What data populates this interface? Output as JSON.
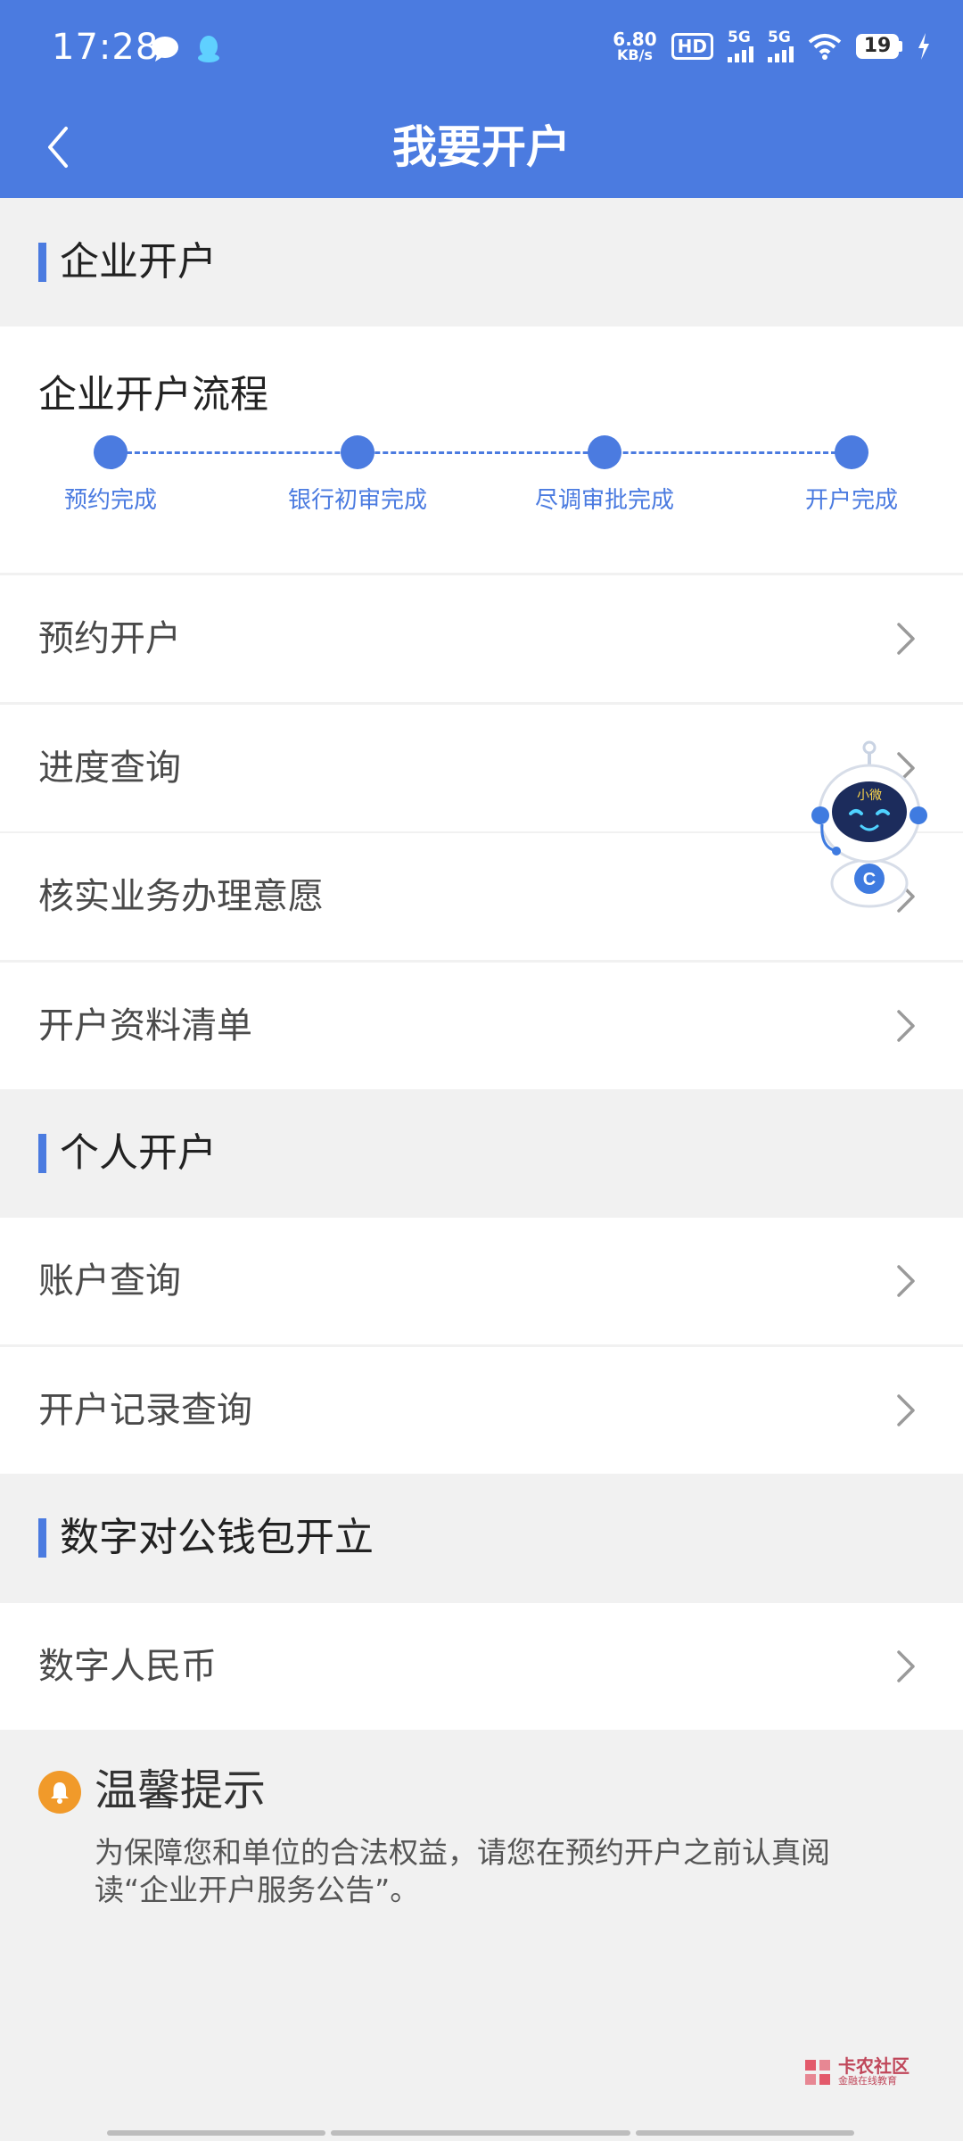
{
  "status_bar": {
    "time": "17:28",
    "net_speed_value": "6.80",
    "net_speed_unit": "KB/s",
    "hd_label": "HD",
    "sim1_label": "5G",
    "sim2_label": "5G",
    "battery": "19"
  },
  "nav": {
    "title": "我要开户"
  },
  "sections": {
    "enterprise": "企业开户",
    "personal": "个人开户",
    "digital_wallet": "数字对公钱包开立"
  },
  "process": {
    "title": "企业开户流程",
    "steps": [
      "预约完成",
      "银行初审完成",
      "尽调审批完成",
      "开户完成"
    ]
  },
  "enterprise_items": [
    "预约开户",
    "进度查询",
    "核实业务办理意愿",
    "开户资料清单"
  ],
  "personal_items": [
    "账户查询",
    "开户记录查询"
  ],
  "digital_items": [
    "数字人民币"
  ],
  "robot": {
    "name": "小微"
  },
  "tips": {
    "title": "温馨提示",
    "text": "为保障您和单位的合法权益，请您在预约开户之前认真阅读“企业开户服务公告”。"
  },
  "watermark": {
    "brand": "卡农社区",
    "tagline": "金融在线教育"
  },
  "colors": {
    "primary": "#4b7be0",
    "tip_orange": "#f19a2a"
  }
}
